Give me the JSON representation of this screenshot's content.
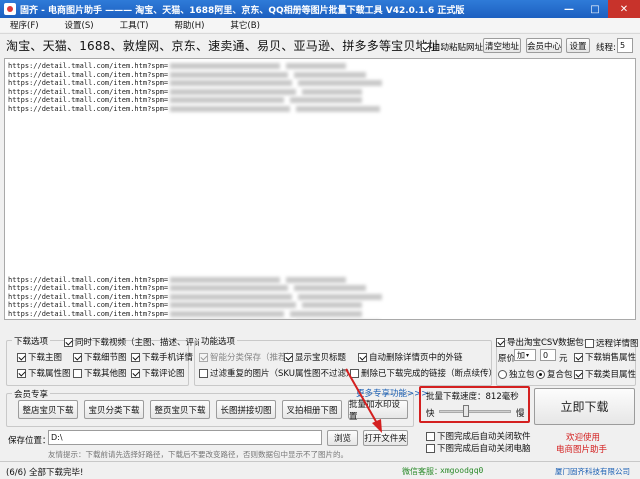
{
  "window": {
    "title": "固齐 - 电商图片助手 ——— 淘宝、天猫、1688阿里、京东、QQ相册等图片批量下载工具 V42.0.1.6 正式版",
    "controls": [
      "—",
      "□",
      "✕"
    ]
  },
  "menu": [
    "程序(F)",
    "设置(S)",
    "工具(T)",
    "帮助(H)",
    "其它(B)"
  ],
  "addr": {
    "label": "淘宝、天猫、1688、敦煌网、京东、速卖通、易贝、亚马逊、拼多多等宝贝地址:",
    "auto_paste": "自动粘贴网址",
    "clear": "清空地址",
    "member": "会员中心",
    "settings": "设置",
    "threads_label": "线程:",
    "threads_value": "5"
  },
  "urls": {
    "prefix": "https://detail.tmall.com/item.htm?spm=",
    "lines": [
      "https://detail.tmall.com/item.htm?spm=",
      "https://detail.tmall.com/item.htm?spm=",
      "https://detail.tmall.com/item.htm?spm=",
      "https://detail.tmall.com/item.htm?spm=",
      "https://detail.tmall.com/item.htm?spm=",
      "https://detail.tmall.com/item.htm?spm=",
      "https://detail.tmall.com/item.htm?spm=",
      "https://detail.tmall.com/item.htm?spm=",
      "https://detail.tmall.com/item.htm?spm=",
      "https://detail.tmall.com/item.htm?spm=",
      "https://detail.tmall.com/item.htm?spm=",
      "https://detail.tmall.com/item.htm?spm="
    ],
    "frags_top": [
      "&id=",
      "...id=",
      "a230r.1.14.",
      "187SC...",
      "3...Frukp",
      "&id=",
      "18...3dab..."
    ]
  },
  "download_opts": {
    "title": "下载选项",
    "items": [
      "同时下载视频（主图、描述、评论）",
      "下载主图",
      "下载细节图",
      "下载手机详情",
      "下载属性图",
      "下载其他图",
      "下载评论图"
    ]
  },
  "func_opts": {
    "title": "功能选项",
    "items": [
      "智能分类保存（推荐）",
      "显示宝贝标题",
      "自动删除详情页中的外链",
      "过滤重复的图片（SKU属性图不过滤）",
      "删除已下载完成的链接（断点续传）"
    ]
  },
  "right_opts": {
    "export_csv": "导出淘宝CSV数据包",
    "detail_links": "远程详情图",
    "price_label": "原价",
    "price_op": "加",
    "price_val": "0",
    "price_unit": "元",
    "sales_attr": "下载销售属性",
    "standalone": "独立包",
    "combined": "复合包",
    "category_attr": "下载类目属性"
  },
  "member": {
    "title": "会员专享",
    "buttons": [
      "整店宝贝下载",
      "宝贝分类下载",
      "整页宝贝下载",
      "长图拼接切图",
      "叉拍相册下图",
      "批量加水印设置"
    ],
    "more": "更多专享功能>>>"
  },
  "speed": {
    "label": "批量下载速度：",
    "value": "812毫秒",
    "fast": "快",
    "slow": "慢",
    "level": 0.35
  },
  "download_now": "立即下载",
  "save": {
    "label": "保存位置：",
    "path": "D:\\",
    "browse": "浏览",
    "open_folder": "打开文件夹",
    "hint": "友情提示：下载前请先选择好路径，下载后不要改变路径，否则数据包中显示不了图片的。"
  },
  "after": {
    "close_soft": "下图完成后自动关闭软件",
    "shutdown": "下图完成后自动关闭电脑"
  },
  "welcome": [
    "欢迎使用",
    "电商图片助手"
  ],
  "status": {
    "text": "(6/6) 全部下载完毕!",
    "wechat_label": "微信客服：",
    "wechat_id": "xmgoodgq0",
    "company": "厦门固齐科技有限公司"
  },
  "colors": {
    "title_bg": "#1c5fc0",
    "highlight": "#d42020",
    "link": "#1a5fb4",
    "wechat": "#2a8a2a"
  }
}
